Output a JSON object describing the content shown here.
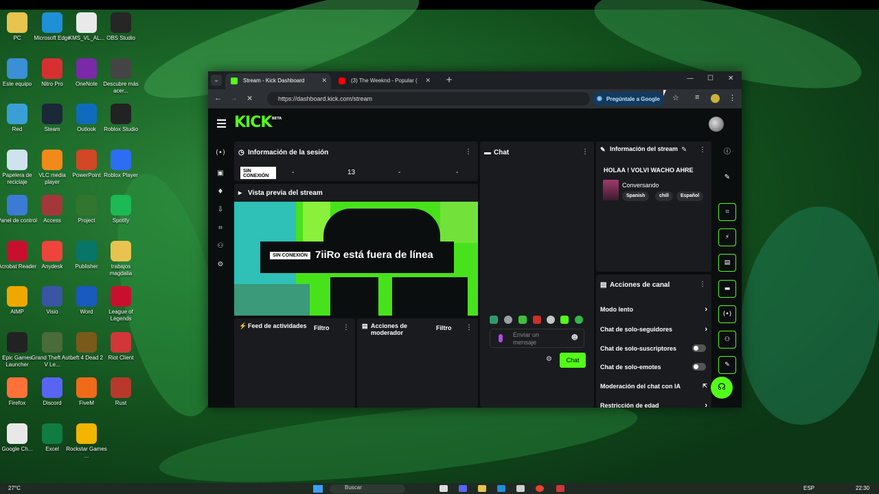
{
  "desktop": {
    "icons": [
      {
        "label": "PC",
        "color": "#e8c350"
      },
      {
        "label": "Microsoft Edge",
        "color": "#1f8fd8"
      },
      {
        "label": "KMS_VL_AL...",
        "color": "#e9e9e9"
      },
      {
        "label": "OBS Studio",
        "color": "#262626"
      },
      {
        "label": "Este equipo",
        "color": "#3a8fd6"
      },
      {
        "label": "Nitro Pro",
        "color": "#d83030"
      },
      {
        "label": "OneNote",
        "color": "#7a2aa8"
      },
      {
        "label": "Descubre más acer...",
        "color": "#444"
      },
      {
        "label": "Red",
        "color": "#3a9fd6"
      },
      {
        "label": "Steam",
        "color": "#1b2838"
      },
      {
        "label": "Outlook",
        "color": "#0f6cbd"
      },
      {
        "label": "Roblox Studio",
        "color": "#222"
      },
      {
        "label": "Papelera de reciclaje",
        "color": "#cfe3ef"
      },
      {
        "label": "VLC media player",
        "color": "#f28a1a"
      },
      {
        "label": "PowerPoint",
        "color": "#d24726"
      },
      {
        "label": "Roblox Player",
        "color": "#2c6df4"
      },
      {
        "label": "Panel de control",
        "color": "#3b7bd4"
      },
      {
        "label": "Access",
        "color": "#a4373a"
      },
      {
        "label": "Project",
        "color": "#31752f"
      },
      {
        "label": "Spotify",
        "color": "#1db954"
      },
      {
        "label": "Acrobat Reader",
        "color": "#c8102e"
      },
      {
        "label": "Anydesk",
        "color": "#ef443b"
      },
      {
        "label": "Publisher",
        "color": "#077568"
      },
      {
        "label": "trabajos magdalia",
        "color": "#e8c350"
      },
      {
        "label": "AIMP",
        "color": "#f0a800"
      },
      {
        "label": "Visio",
        "color": "#3955a3"
      },
      {
        "label": "Word",
        "color": "#185abd"
      },
      {
        "label": "League of Legends",
        "color": "#c8102e"
      },
      {
        "label": "Epic Games Launcher",
        "color": "#222"
      },
      {
        "label": "Grand Theft Auto V Le...",
        "color": "#4a6b3a"
      },
      {
        "label": "Left 4 Dead 2",
        "color": "#7a5a1a"
      },
      {
        "label": "Riot Client",
        "color": "#d13639"
      },
      {
        "label": "Firefox",
        "color": "#ff7139"
      },
      {
        "label": "Discord",
        "color": "#5865f2"
      },
      {
        "label": "FiveM",
        "color": "#f06a1a"
      },
      {
        "label": "Rust",
        "color": "#b8382c"
      },
      {
        "label": "Google Ch...",
        "color": "#e8e8e8"
      },
      {
        "label": "Excel",
        "color": "#107c41"
      },
      {
        "label": "Rockstar Games ...",
        "color": "#f3b500"
      }
    ]
  },
  "taskbar": {
    "weather": "27°C",
    "search": "Buscar",
    "lang": "ESP",
    "time": "22:30"
  },
  "browser": {
    "tab_active": "Stream - Kick Dashboard",
    "tab_other": "(3) The Weeknd - Popular (",
    "url": "https://dashboard.kick.com/stream",
    "ask_google": "Pregúntale a Google"
  },
  "kick": {
    "logo": "KICK",
    "beta": "BETA",
    "session": {
      "title": "Información de la sesión",
      "status": "SIN CONEXIÓN",
      "values": [
        "-",
        "13",
        "-",
        "-"
      ]
    },
    "preview": {
      "title": "Vista previa del stream",
      "badge": "SIN CONEXIÓN",
      "text": "7iiRo está fuera de línea"
    },
    "feed": {
      "title": "Feed de actividades",
      "filter": "Filtro"
    },
    "mod": {
      "title": "Acciones de moderador",
      "filter": "Filtro"
    },
    "chat": {
      "title": "Chat",
      "placeholder": "Enviar un mensaje",
      "button": "Chat"
    },
    "stream_info": {
      "title": "Información del stream",
      "stream_title": "HOLAA ! VOLVI WACHO AHRE",
      "category": "Conversando",
      "tags": [
        "Spanish",
        "chill",
        "Español"
      ]
    },
    "channel_actions": {
      "title": "Acciones de canal",
      "rows": [
        {
          "label": "Modo lento",
          "control": "chevron"
        },
        {
          "label": "Chat de solo-seguidores",
          "control": "chevron"
        },
        {
          "label": "Chat de solo-suscriptores",
          "control": "toggle"
        },
        {
          "label": "Chat de solo-emotes",
          "control": "toggle"
        },
        {
          "label": "Moderación del chat con IA",
          "control": "external"
        },
        {
          "label": "Restricción de edad",
          "control": "chevron"
        }
      ]
    }
  }
}
